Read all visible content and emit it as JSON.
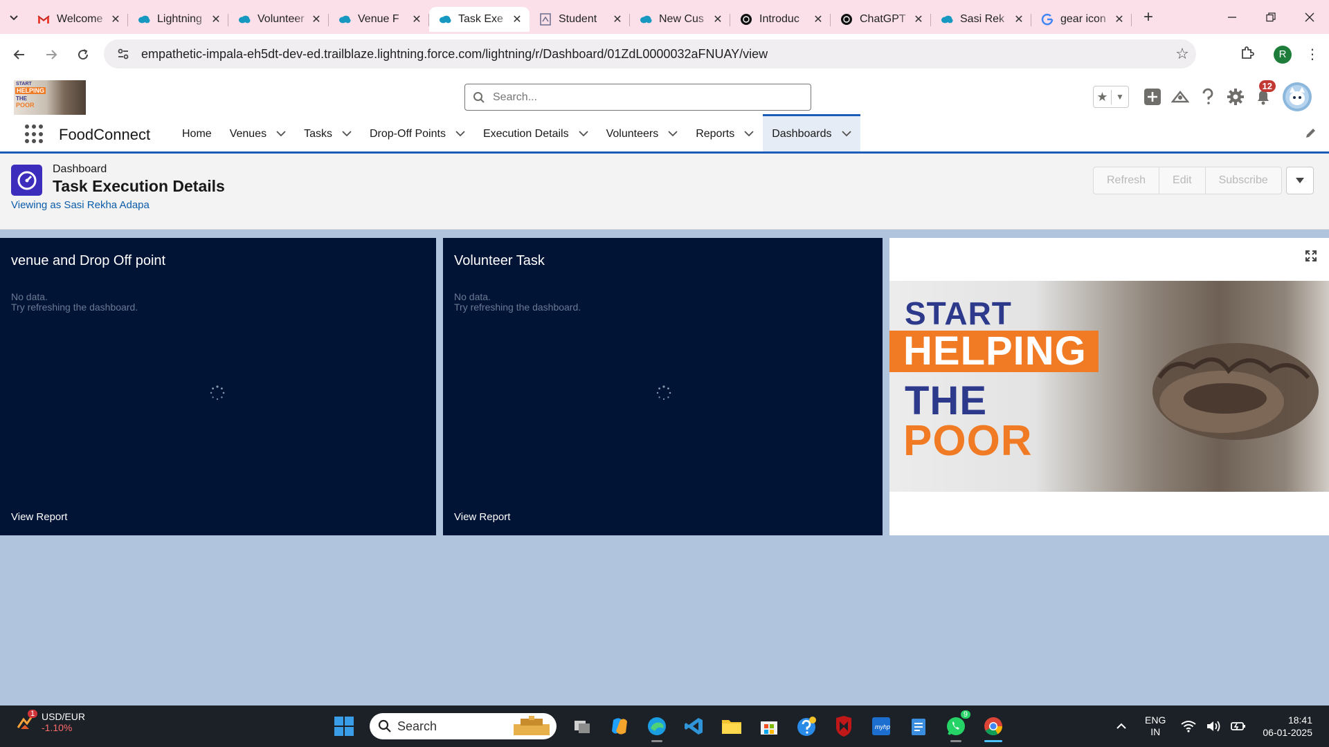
{
  "browser": {
    "tabs": [
      {
        "label": "Welcome",
        "icon": "gmail-icon",
        "active": false
      },
      {
        "label": "Lightning",
        "icon": "salesforce-cloud-icon",
        "active": false
      },
      {
        "label": "Volunteer",
        "icon": "salesforce-cloud-icon",
        "active": false
      },
      {
        "label": "Venue F",
        "icon": "salesforce-cloud-icon",
        "active": false
      },
      {
        "label": "Task Exe",
        "icon": "salesforce-cloud-icon",
        "active": true
      },
      {
        "label": "Student",
        "icon": "document-icon",
        "active": false
      },
      {
        "label": "New Cus",
        "icon": "salesforce-cloud-icon",
        "active": false
      },
      {
        "label": "Introduc",
        "icon": "chatgpt-icon",
        "active": false
      },
      {
        "label": "ChatGPT",
        "icon": "chatgpt-icon",
        "active": false
      },
      {
        "label": "Sasi Rek",
        "icon": "salesforce-cloud-icon",
        "active": false
      },
      {
        "label": "gear icon",
        "icon": "google-icon",
        "active": false
      }
    ],
    "url": "empathetic-impala-eh5dt-dev-ed.trailblaze.lightning.force.com/lightning/r/Dashboard/01ZdL0000032aFNUAY/view",
    "profile_initial": "R"
  },
  "header": {
    "logo": {
      "l1": "START",
      "l2": "HELPING",
      "l3": "THE",
      "l4": "POOR"
    },
    "search_placeholder": "Search...",
    "notification_count": "12"
  },
  "nav": {
    "app_name": "FoodConnect",
    "items": [
      {
        "label": "Home",
        "has_menu": false
      },
      {
        "label": "Venues",
        "has_menu": true
      },
      {
        "label": "Tasks",
        "has_menu": true
      },
      {
        "label": "Drop-Off Points",
        "has_menu": true
      },
      {
        "label": "Execution Details",
        "has_menu": true
      },
      {
        "label": "Volunteers",
        "has_menu": true
      },
      {
        "label": "Reports",
        "has_menu": true
      },
      {
        "label": "Dashboards",
        "has_menu": true,
        "active": true
      }
    ]
  },
  "dashboard": {
    "type_label": "Dashboard",
    "title": "Task Execution Details",
    "viewing_as": "Viewing as Sasi Rekha Adapa",
    "buttons": {
      "refresh": "Refresh",
      "edit": "Edit",
      "subscribe": "Subscribe"
    }
  },
  "widgets": [
    {
      "title": "venue and Drop Off point",
      "nodata1": "No data.",
      "nodata2": "Try refreshing the dashboard.",
      "link": "View Report"
    },
    {
      "title": "Volunteer Task",
      "nodata1": "No data.",
      "nodata2": "Try refreshing the dashboard.",
      "link": "View Report"
    }
  ],
  "banner": {
    "line1": "START",
    "line2": "HELPING",
    "line3": "THE",
    "line4": "POOR"
  },
  "taskbar": {
    "weather_badge": "1",
    "ticker_name": "USD/EUR",
    "ticker_change": "-1.10%",
    "search_label": "Search",
    "whatsapp_badge": "9",
    "lang_line1": "ENG",
    "lang_line2": "IN",
    "time": "18:41",
    "date": "06-01-2025"
  },
  "colors": {
    "nav_accent": "#1b5cb8",
    "widget_bg": "#011436",
    "canvas_bg": "#b0c4de",
    "dashboard_icon": "#3c2dbd",
    "banner_orange": "#f07b24",
    "banner_blue": "#2d3a8c"
  }
}
